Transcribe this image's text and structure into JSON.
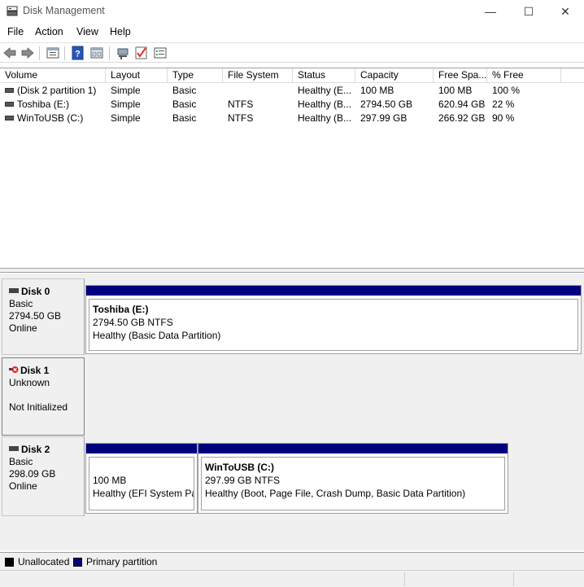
{
  "window": {
    "title": "Disk Management",
    "minimize": "—",
    "maximize": "☐",
    "close": "✕"
  },
  "menu": [
    "File",
    "Action",
    "View",
    "Help"
  ],
  "toolbar_icons": [
    "back-icon",
    "forward-icon",
    "show-hide-console-tree-icon",
    "help-icon",
    "properties-icon",
    "connect-icon",
    "check-icon",
    "settings-icon"
  ],
  "volume_list": {
    "columns": [
      "Volume",
      "Layout",
      "Type",
      "File System",
      "Status",
      "Capacity",
      "Free Spa...",
      "% Free"
    ],
    "rows": [
      [
        "(Disk 2 partition 1)",
        "Simple",
        "Basic",
        "",
        "Healthy (E...",
        "100 MB",
        "100 MB",
        "100 %"
      ],
      [
        "Toshiba (E:)",
        "Simple",
        "Basic",
        "NTFS",
        "Healthy (B...",
        "2794.50 GB",
        "620.94 GB",
        "22 %"
      ],
      [
        "WinToUSB (C:)",
        "Simple",
        "Basic",
        "NTFS",
        "Healthy (B...",
        "297.99 GB",
        "266.92 GB",
        "90 %"
      ]
    ]
  },
  "disks": [
    {
      "name": "Disk 0",
      "type": "Basic",
      "size": "2794.50 GB",
      "state": "Online",
      "partitions": [
        {
          "name": "Toshiba  (E:)",
          "size": "2794.50 GB NTFS",
          "status": "Healthy (Basic Data Partition)"
        }
      ]
    },
    {
      "name": "Disk 1",
      "type": "Unknown",
      "size": "",
      "state": "Not Initialized",
      "partitions": []
    },
    {
      "name": "Disk 2",
      "type": "Basic",
      "size": "298.09 GB",
      "state": "Online",
      "partitions": [
        {
          "name": "",
          "size": "100 MB",
          "status": "Healthy (EFI System Par"
        },
        {
          "name": "WinToUSB  (C:)",
          "size": "297.99 GB NTFS",
          "status": "Healthy (Boot, Page File, Crash Dump, Basic Data Partition)"
        }
      ]
    }
  ],
  "legend": [
    {
      "label": "Unallocated",
      "color": "#000000"
    },
    {
      "label": "Primary partition",
      "color": "#00007f"
    }
  ]
}
